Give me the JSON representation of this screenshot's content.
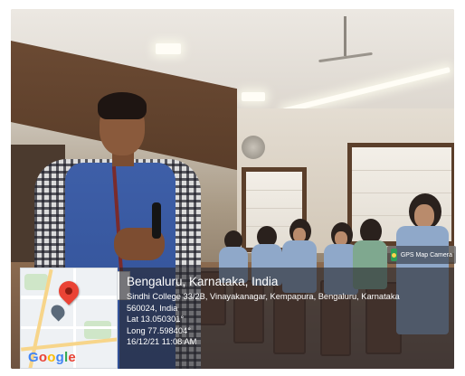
{
  "photo": {
    "description_hidden": ""
  },
  "badge": {
    "label": "GPS Map Camera",
    "icon": "gps-map-camera-icon"
  },
  "map": {
    "logo_letters": [
      "G",
      "o",
      "o",
      "g",
      "l",
      "e"
    ],
    "logo_colors": [
      "#4285F4",
      "#EA4335",
      "#FBBC05",
      "#4285F4",
      "#34A853",
      "#EA4335"
    ],
    "pin_icon": "map-pin-icon"
  },
  "location": {
    "title": "Bengaluru, Karnataka, India",
    "address_line1": "Sindhi College 33/2B, Vinayakanagar, Kempapura, Bengaluru, Karnataka",
    "address_line2": "560024, India",
    "lat": "Lat 13.050301°",
    "long": "Long 77.598404°",
    "datetime": "16/12/21 11:08 AM"
  },
  "colors": {
    "overlay_bg": "rgba(40,40,46,0.62)",
    "vest": "#3e5fa8"
  }
}
